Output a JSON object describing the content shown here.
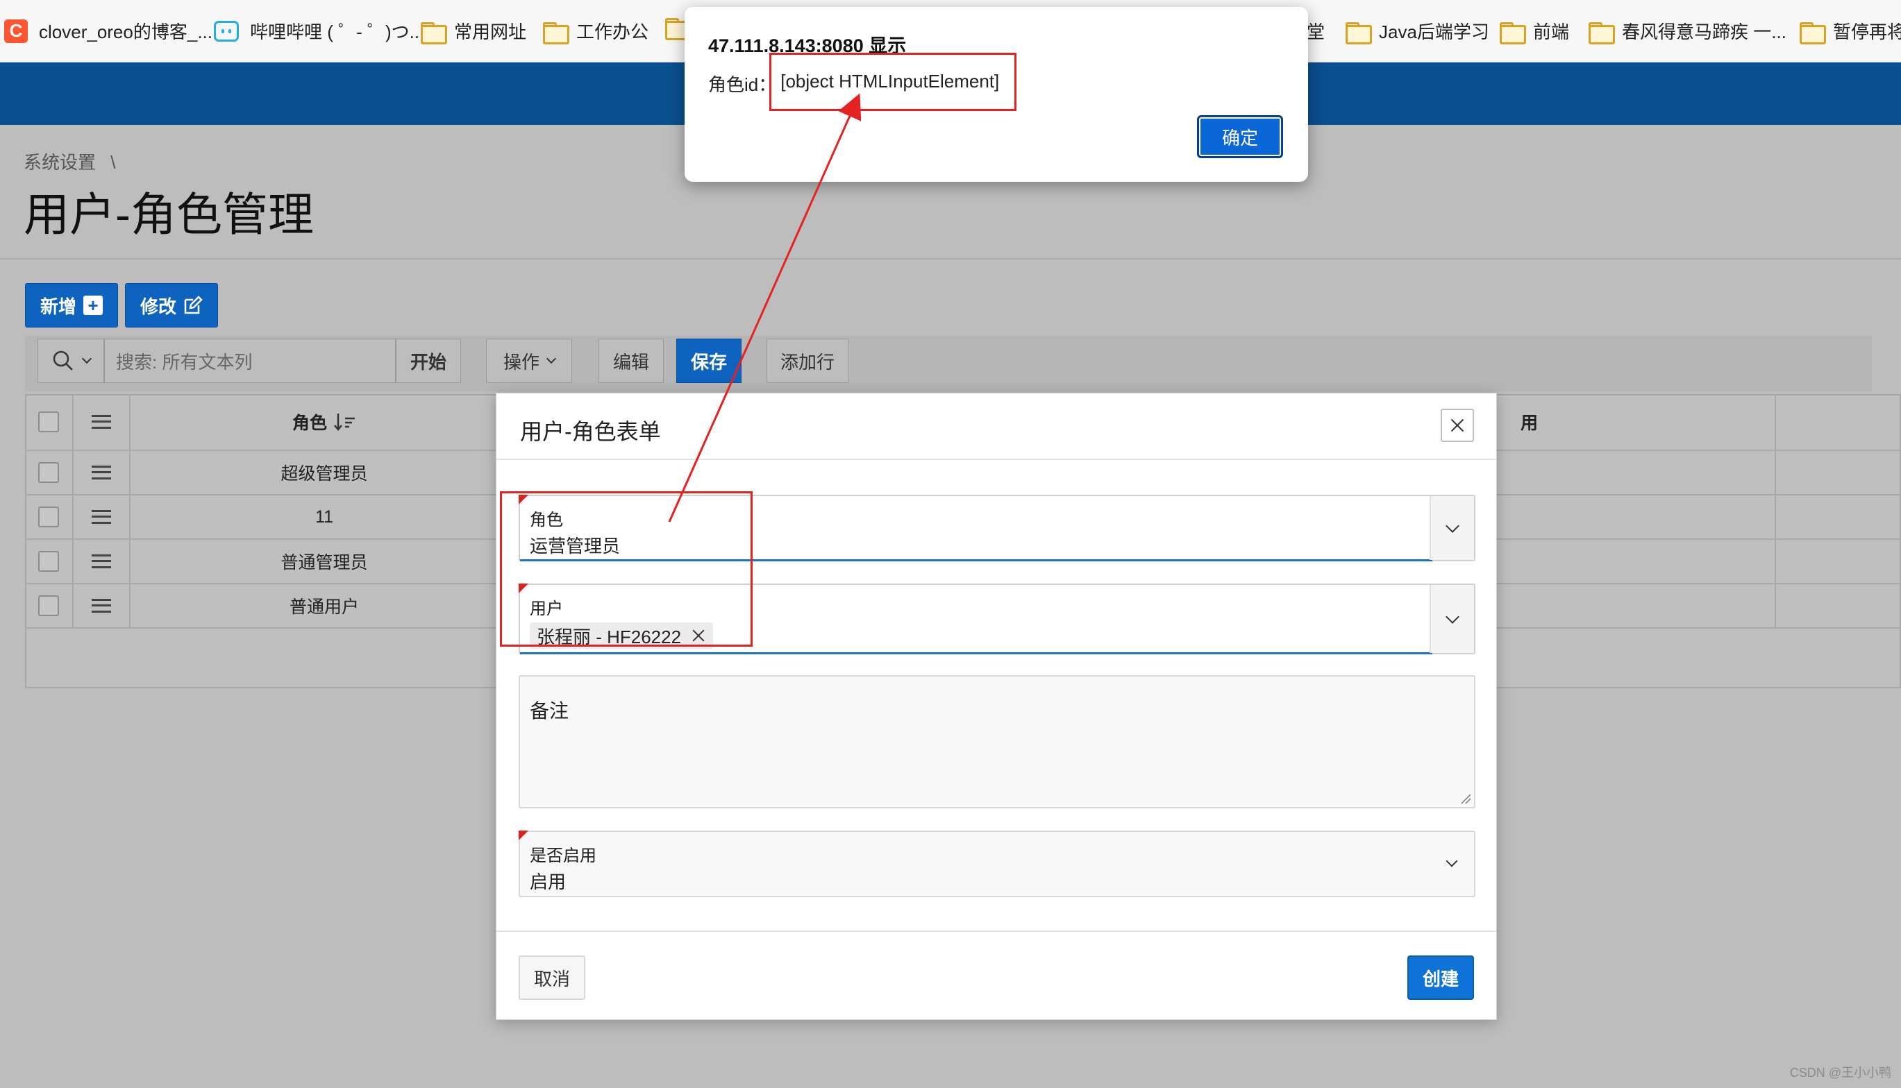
{
  "bookmarks": [
    {
      "label": "clover_oreo的博客_...",
      "icon": "csdn-icon"
    },
    {
      "label": "哔哩哔哩 ( ゜- ゜)つ...",
      "icon": "bilibili-icon"
    },
    {
      "label": "常用网址",
      "icon": "folder-icon"
    },
    {
      "label": "工作办公",
      "icon": "folder-icon"
    },
    {
      "label": "堂",
      "icon": ""
    },
    {
      "label": "Java后端学习",
      "icon": "folder-icon"
    },
    {
      "label": "前端",
      "icon": "folder-icon"
    },
    {
      "label": "春风得意马蹄疾 一...",
      "icon": "folder-icon"
    },
    {
      "label": "暂停再将",
      "icon": "folder-icon"
    }
  ],
  "breadcrumb": {
    "item": "系统设置",
    "separator": "\\"
  },
  "page_title": "用户-角色管理",
  "buttons": {
    "add": "新增",
    "edit": "修改",
    "add_icon": "+"
  },
  "toolbar": {
    "search_placeholder": "搜索: 所有文本列",
    "go": "开始",
    "actions": "操作",
    "edit": "编辑",
    "save": "保存",
    "add_row": "添加行"
  },
  "grid": {
    "headers": {
      "role": "角色",
      "enabled_partial": "用"
    },
    "rows": [
      "超级管理员",
      "11",
      "普通管理员",
      "普通用户"
    ]
  },
  "dialog": {
    "title": "用户-角色表单",
    "role_label": "角色",
    "role_value": "运营管理员",
    "user_label": "用户",
    "user_chip": "张程丽 - HF26222",
    "remark_label": "备注",
    "enabled_label": "是否启用",
    "enabled_value": "启用",
    "cancel": "取消",
    "create": "创建"
  },
  "alert": {
    "origin": "47.111.8.143:8080 显示",
    "message_label": "角色id：",
    "message_value": "[object HTMLInputElement]",
    "ok": "确定"
  },
  "watermark": "CSDN @王小小鸭",
  "colors": {
    "header": "#0a4f8f",
    "primary": "#0d63bd",
    "annotation": "#e52222",
    "required": "#e0201a"
  }
}
